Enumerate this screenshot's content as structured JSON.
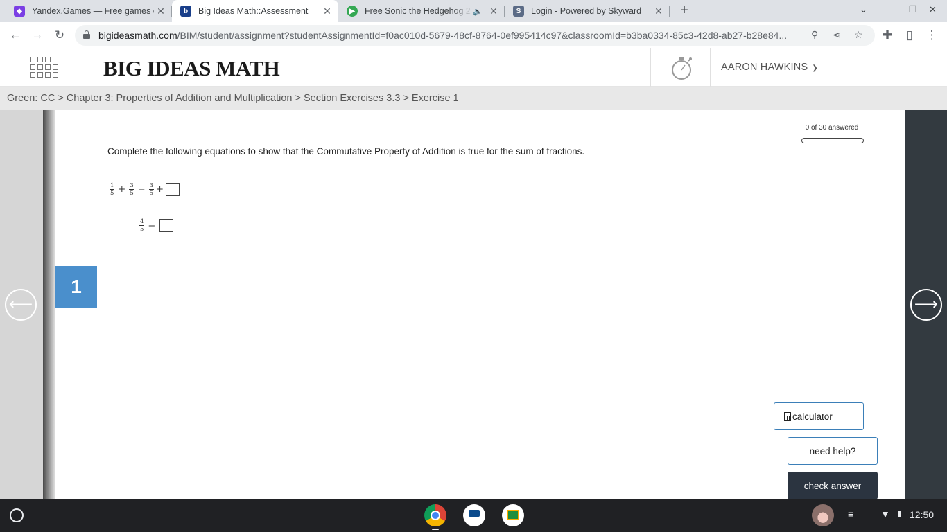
{
  "browser": {
    "tabs": [
      {
        "title": "Yandex.Games — Free games on",
        "favicon": "yandex-games-icon",
        "active": false
      },
      {
        "title": "Big Ideas Math::Assessment",
        "favicon": "big-ideas-icon",
        "active": true
      },
      {
        "title": "Free Sonic the Hedgehog 2",
        "favicon": "play-icon",
        "active": false,
        "audio": true
      },
      {
        "title": "Login - Powered by Skyward",
        "favicon": "skyward-icon",
        "active": false
      }
    ],
    "url_domain": "bigideasmath.com",
    "url_path": "/BIM/student/assignment?studentAssignmentId=f0ac010d-5679-48cf-8764-0ef995414c97&classroomId=b3ba0334-85c3-42d8-ab27-b28e84..."
  },
  "header": {
    "logo": "BIG IDEAS MATH",
    "user_name": "AARON HAWKINS"
  },
  "breadcrumb": "Green: CC > Chapter 3: Properties of Addition and Multiplication > Section Exercises 3.3 > Exercise 1",
  "progress": {
    "label": "0 of 30 answered",
    "answered": 0,
    "total": 30
  },
  "question": {
    "number": "1",
    "prompt": "Complete the following equations to show that the Commutative Property of Addition is true for the sum of fractions.",
    "eq1": {
      "a_num": "1",
      "a_den": "5",
      "plus1": "+",
      "b_num": "3",
      "b_den": "5",
      "equals": "=",
      "c_num": "3",
      "c_den": "5",
      "plus2": "+"
    },
    "eq2": {
      "num": "4",
      "den": "5",
      "equals": "="
    }
  },
  "buttons": {
    "calculator": "calculator",
    "need_help": "need help?",
    "check_answer": "check answer"
  },
  "nav": {
    "prev_arrow": "⟵",
    "next_arrow": "⟶"
  },
  "shelf": {
    "time": "12:50"
  },
  "colors": {
    "accent_blue": "#4a8fcc",
    "dark_button": "#2b3440",
    "right_panel": "#333a40"
  }
}
